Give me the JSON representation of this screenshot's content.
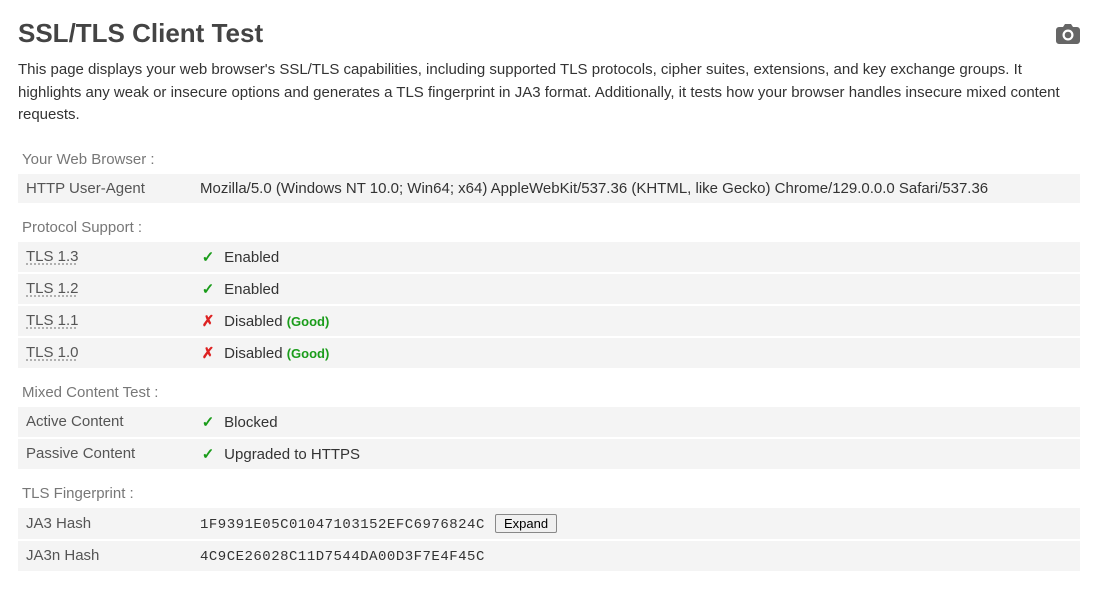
{
  "page": {
    "title": "SSL/TLS Client Test",
    "intro": "This page displays your web browser's SSL/TLS capabilities, including supported TLS protocols, cipher suites, extensions, and key exchange groups. It highlights any weak or insecure options and generates a TLS fingerprint in JA3 format. Additionally, it tests how your browser handles insecure mixed content requests."
  },
  "sections": {
    "browser": {
      "label": "Your Web Browser :",
      "user_agent_key": "HTTP User-Agent",
      "user_agent_value": "Mozilla/5.0 (Windows NT 10.0; Win64; x64) AppleWebKit/537.36 (KHTML, like Gecko) Chrome/129.0.0.0 Safari/537.36"
    },
    "protocol": {
      "label": "Protocol Support :",
      "rows": [
        {
          "key": "TLS 1.3",
          "icon": "check",
          "status": "Enabled",
          "note": ""
        },
        {
          "key": "TLS 1.2",
          "icon": "check",
          "status": "Enabled",
          "note": ""
        },
        {
          "key": "TLS 1.1",
          "icon": "cross",
          "status": "Disabled",
          "note": "(Good)"
        },
        {
          "key": "TLS 1.0",
          "icon": "cross",
          "status": "Disabled",
          "note": "(Good)"
        }
      ]
    },
    "mixed": {
      "label": "Mixed Content Test :",
      "rows": [
        {
          "key": "Active Content",
          "icon": "check",
          "status": "Blocked"
        },
        {
          "key": "Passive Content",
          "icon": "check",
          "status": "Upgraded to HTTPS"
        }
      ]
    },
    "fingerprint": {
      "label": "TLS Fingerprint :",
      "ja3_key": "JA3 Hash",
      "ja3_value": "1F9391E05C01047103152EFC6976824C",
      "expand_label": "Expand",
      "ja3n_key": "JA3n Hash",
      "ja3n_value": "4C9CE26028C11D7544DA00D3F7E4F45C"
    }
  },
  "glyphs": {
    "check": "✓",
    "cross": "✗"
  }
}
